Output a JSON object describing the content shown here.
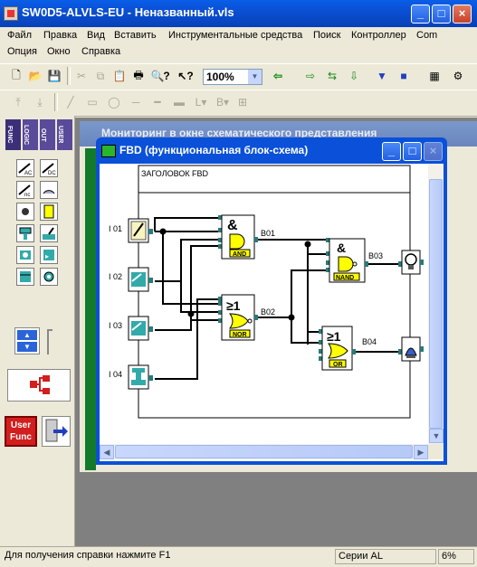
{
  "app": {
    "title": "SW0D5-ALVLS-EU - Неназванный.vls",
    "buttons": {
      "minimize": "_",
      "maximize": "□",
      "close": "×"
    }
  },
  "menu": {
    "row1": [
      "Файл",
      "Правка",
      "Вид",
      "Вставить",
      "Инструментальные средства",
      "Поиск",
      "Контроллер",
      "Com"
    ],
    "row2": [
      "Опция",
      "Окно",
      "Справка"
    ]
  },
  "toolbar": {
    "zoom": "100%",
    "zoom_arrow": "▼"
  },
  "palette": {
    "tabs": [
      "FUNC",
      "LOGIC",
      "OUT",
      "USER"
    ],
    "userfunc": [
      "User",
      "Func"
    ]
  },
  "mdi": {
    "back_window_title": "Мониторинг в окне схематического представления",
    "fbd_title": "FBD (функциональная блок-схема)"
  },
  "diagram": {
    "header": "ЗАГОЛОВОК FBD",
    "inputs": [
      "I 01",
      "I 02",
      "I 03",
      "I 04"
    ],
    "blocks": [
      {
        "id": "B01",
        "symbol": "&",
        "label": "AND"
      },
      {
        "id": "B02",
        "symbol": "≥1",
        "label": "NOR"
      },
      {
        "id": "B03",
        "symbol": "&",
        "label": "NAND"
      },
      {
        "id": "B04",
        "symbol": "≥1",
        "label": "OR"
      }
    ]
  },
  "status": {
    "help": "Для получения справки нажмите F1",
    "series": "Серии AL",
    "percent": "6%"
  },
  "colors": {
    "title_blue": "#0a4fd3",
    "gate_yellow": "#ffff00",
    "port_teal": "#2a7a7a",
    "palette_red": "#d21e1e"
  }
}
